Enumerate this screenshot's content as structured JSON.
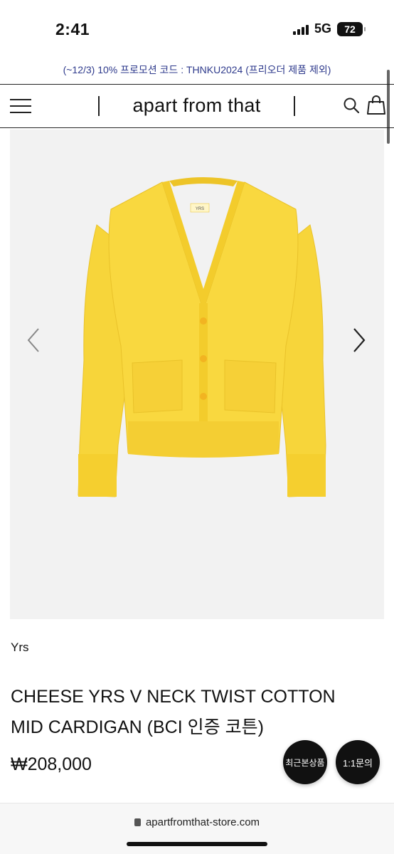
{
  "status_bar": {
    "time": "2:41",
    "network": "5G",
    "battery": "72",
    "signal_bars": 4
  },
  "promo_text": "(~12/3) 10% 프로모션 코드 : THNKU2024 (프리오더 제품 제외)",
  "header": {
    "brand": "apart from that",
    "icons": [
      "menu-icon",
      "search-icon",
      "shopping-bag-icon"
    ]
  },
  "gallery": {
    "prev_icon": "chevron-left-icon",
    "next_icon": "chevron-right-icon",
    "product_color": "#F7D53A",
    "label_text": "YRS"
  },
  "product": {
    "brand": "Yrs",
    "title_line1": "CHEESE YRS V NECK TWIST COTTON",
    "title_line2": "MID CARDIGAN (BCI 인증 코튼)",
    "price": "₩208,000"
  },
  "floating_buttons": {
    "recent": "최근본상품",
    "inquiry": "1:1문의"
  },
  "browser": {
    "url": "apartfromthat-store.com"
  },
  "colors": {
    "promo": "#2E3A8C",
    "accent": "#111111"
  }
}
